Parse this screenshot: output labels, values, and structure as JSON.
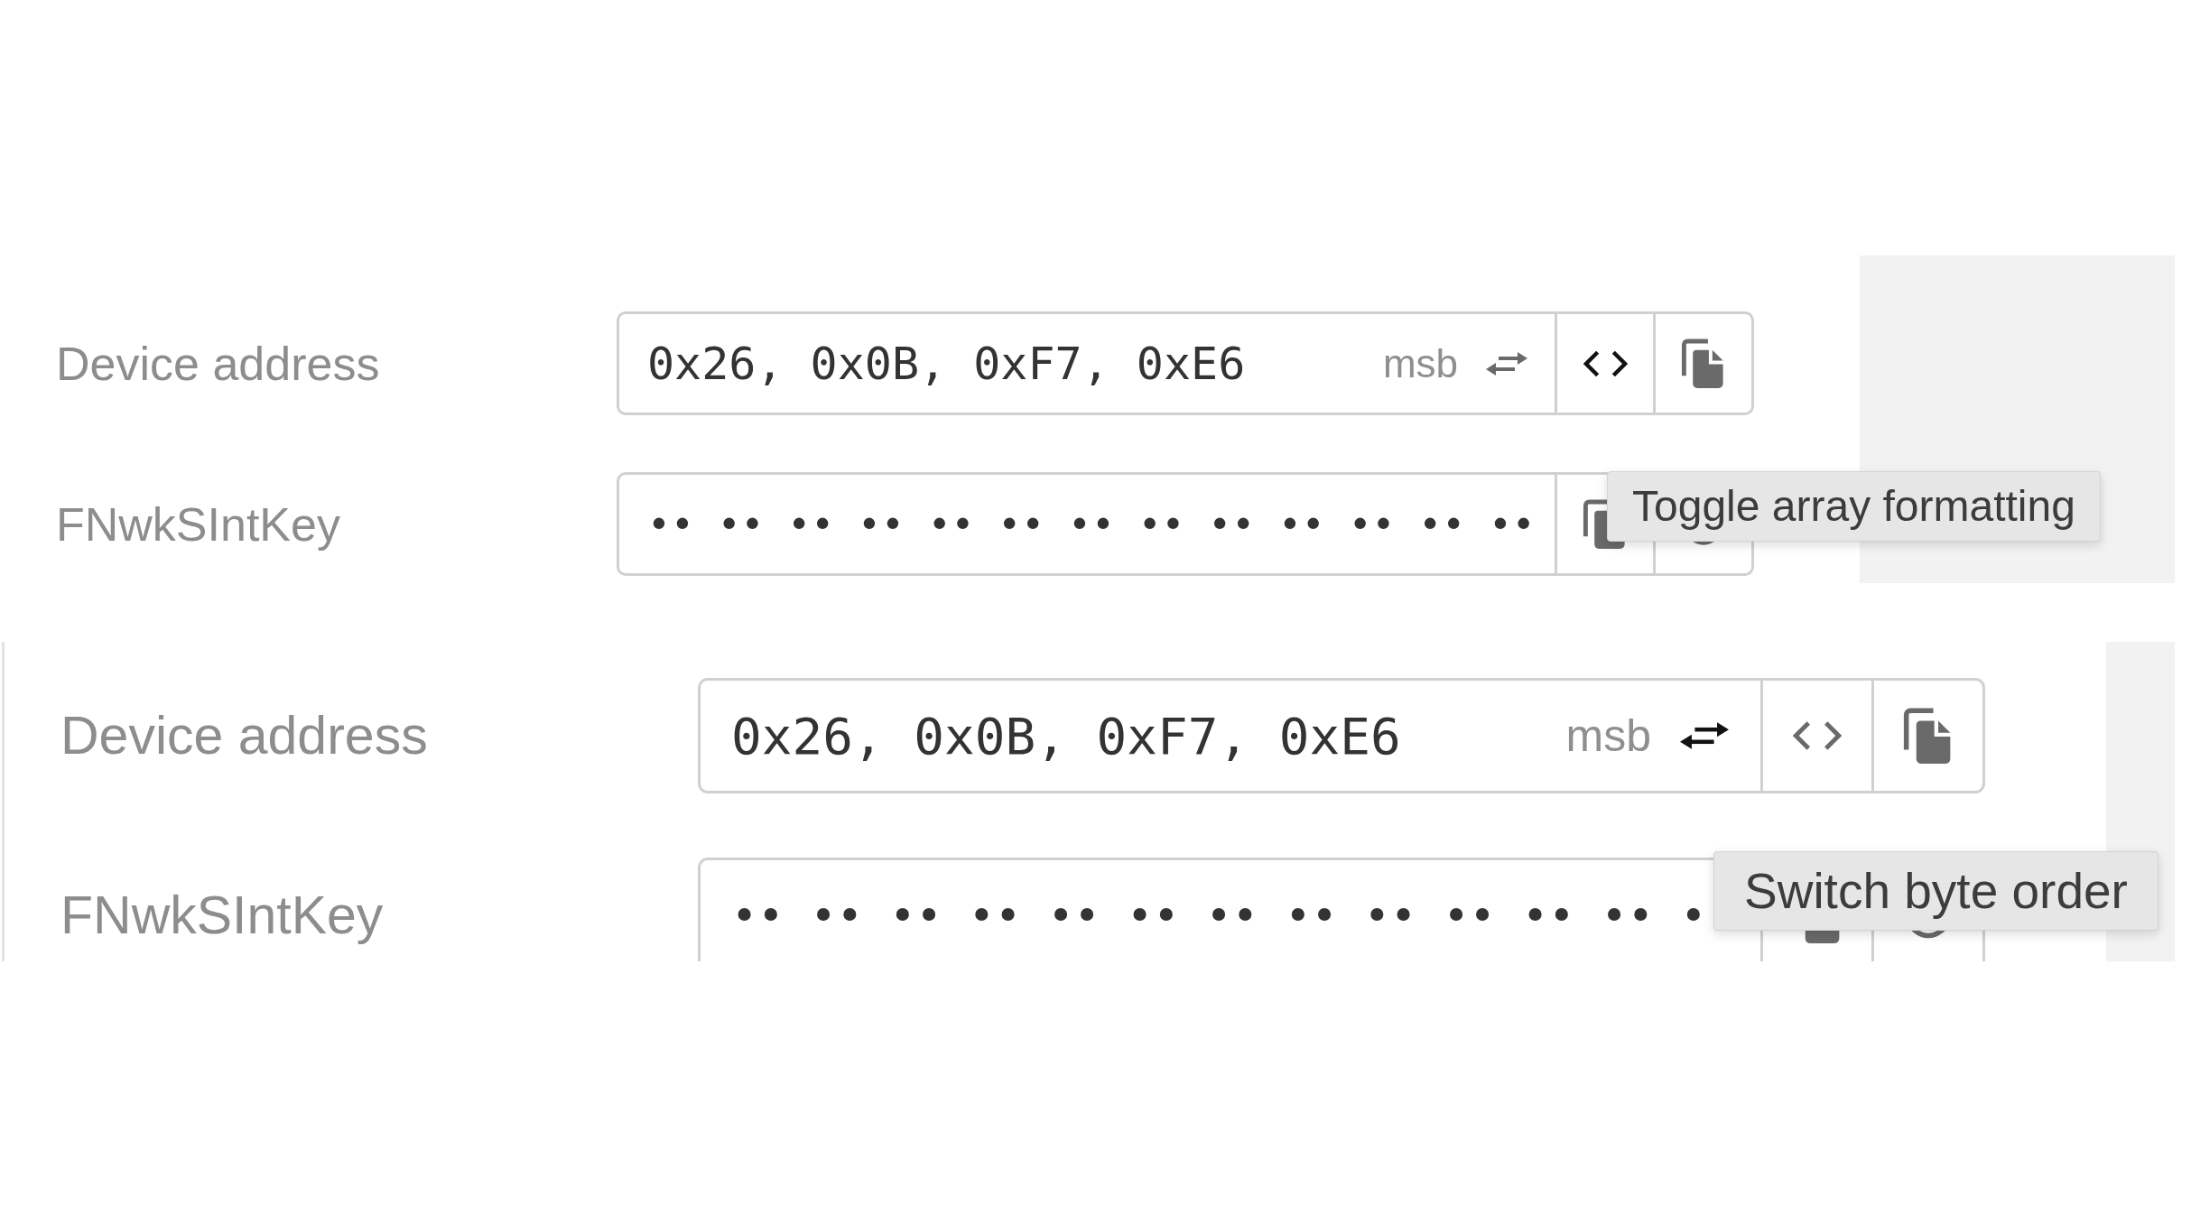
{
  "panels": [
    {
      "rows": [
        {
          "kind": "address",
          "label": "Device address",
          "value": "0x26, 0x0B, 0xF7, 0xE6",
          "byte_order": "msb",
          "controls": [
            {
              "kind": "swap",
              "hovered": false
            },
            {
              "kind": "format",
              "hovered": true
            },
            {
              "kind": "copy",
              "hovered": false
            }
          ]
        },
        {
          "kind": "key",
          "label": "FNwkSIntKey",
          "value": "•• •• •• •• •• •• •• •• •• •• •• •• ••",
          "controls": [
            {
              "kind": "copy",
              "hovered": false
            },
            {
              "kind": "reveal",
              "hovered": false
            }
          ]
        }
      ],
      "tooltip": "Toggle array formatting"
    },
    {
      "rows": [
        {
          "kind": "address",
          "label": "Device address",
          "value": "0x26, 0x0B, 0xF7, 0xE6",
          "byte_order": "msb",
          "controls": [
            {
              "kind": "swap",
              "hovered": true
            },
            {
              "kind": "format",
              "hovered": false
            },
            {
              "kind": "copy",
              "hovered": false
            }
          ]
        },
        {
          "kind": "key",
          "label": "FNwkSIntKey",
          "value": "•• •• •• •• •• •• •• •• •• •• •• •• •",
          "controls": [
            {
              "kind": "copy",
              "hovered": false
            },
            {
              "kind": "reveal",
              "hovered": false
            }
          ]
        }
      ],
      "tooltip": "Switch byte order"
    }
  ]
}
